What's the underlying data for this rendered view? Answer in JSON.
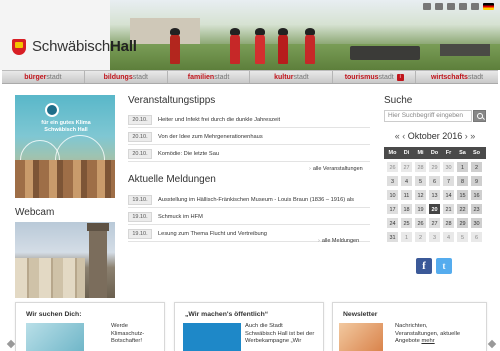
{
  "header": {
    "logo_regular": "Schwäbisch",
    "logo_bold": "Hall"
  },
  "nav": [
    {
      "strong": "bürger",
      "light": "stadt",
      "badge": ""
    },
    {
      "strong": "bildungs",
      "light": "stadt",
      "badge": ""
    },
    {
      "strong": "familien",
      "light": "stadt",
      "badge": ""
    },
    {
      "strong": "kultur",
      "light": "stadt",
      "badge": ""
    },
    {
      "strong": "tourismus",
      "light": "stadt",
      "badge": "i"
    },
    {
      "strong": "wirtschafts",
      "light": "stadt",
      "badge": ""
    }
  ],
  "klima": {
    "text": "für ein gutes Klima Schwäbisch Hall"
  },
  "webcam": {
    "title": "Webcam"
  },
  "events": {
    "title": "Veranstaltungstipps",
    "items": [
      {
        "date": "20.10.",
        "text": "Heiter und Infekt frei durch die dunkle Jahreszeit"
      },
      {
        "date": "20.10.",
        "text": "Von der Idee zum Mehrgenerationenhaus"
      },
      {
        "date": "20.10.",
        "text": "Komödie: Die letzte Sau"
      }
    ],
    "more": "alle Veranstaltungen"
  },
  "news": {
    "title": "Aktuelle Meldungen",
    "items": [
      {
        "date": "19.10.",
        "text": "Ausstellung im Hällisch-Fränkischen Museum - Louis Braun (1836 – 1916) als"
      },
      {
        "date": "19.10.",
        "text": "Schmuck im HFM"
      },
      {
        "date": "19.10.",
        "text": "Lesung zum Thema Flucht und Vertreibung"
      }
    ],
    "more": "alle Meldungen"
  },
  "search": {
    "title": "Suche",
    "placeholder": "Hier Suchbegriff eingeben"
  },
  "calendar": {
    "prev": "« ‹",
    "month": "Oktober 2016",
    "next": "› »",
    "weekdays": [
      "Mo",
      "Di",
      "Mi",
      "Do",
      "Fr",
      "Sa",
      "So"
    ],
    "weeks": [
      [
        {
          "d": "26",
          "o": true
        },
        {
          "d": "27",
          "o": true
        },
        {
          "d": "28",
          "o": true
        },
        {
          "d": "29",
          "o": true
        },
        {
          "d": "30",
          "o": true
        },
        {
          "d": "1"
        },
        {
          "d": "2"
        }
      ],
      [
        {
          "d": "3"
        },
        {
          "d": "4"
        },
        {
          "d": "5"
        },
        {
          "d": "6"
        },
        {
          "d": "7"
        },
        {
          "d": "8"
        },
        {
          "d": "9"
        }
      ],
      [
        {
          "d": "10"
        },
        {
          "d": "11"
        },
        {
          "d": "12"
        },
        {
          "d": "13"
        },
        {
          "d": "14"
        },
        {
          "d": "15"
        },
        {
          "d": "16"
        }
      ],
      [
        {
          "d": "17"
        },
        {
          "d": "18"
        },
        {
          "d": "19"
        },
        {
          "d": "20",
          "today": true
        },
        {
          "d": "21"
        },
        {
          "d": "22"
        },
        {
          "d": "23"
        }
      ],
      [
        {
          "d": "24"
        },
        {
          "d": "25"
        },
        {
          "d": "26"
        },
        {
          "d": "27"
        },
        {
          "d": "28"
        },
        {
          "d": "29"
        },
        {
          "d": "30"
        }
      ],
      [
        {
          "d": "31"
        },
        {
          "d": "1",
          "o": true
        },
        {
          "d": "2",
          "o": true
        },
        {
          "d": "3",
          "o": true
        },
        {
          "d": "4",
          "o": true
        },
        {
          "d": "5",
          "o": true
        },
        {
          "d": "6",
          "o": true
        }
      ]
    ]
  },
  "social": {
    "facebook": "f",
    "twitter": "t"
  },
  "boxes": [
    {
      "title": "Wir suchen Dich:",
      "lines": [
        "Werde",
        "Klimaschutz-",
        "Botschafter!"
      ]
    },
    {
      "title": "„Wir machen's öffentlich“",
      "lines": [
        "Auch die Stadt",
        "Schwäbisch Hall ist bei der",
        "Werbekampagne „Wir"
      ]
    },
    {
      "title": "Newsletter",
      "lines": [
        "Nachrichten,",
        "Veranstaltungen, aktuelle"
      ],
      "last_line": "Angebote",
      "link": "mehr"
    }
  ],
  "colors": {
    "accent": "#c0141b",
    "calendar_header": "#4a4a4a"
  }
}
